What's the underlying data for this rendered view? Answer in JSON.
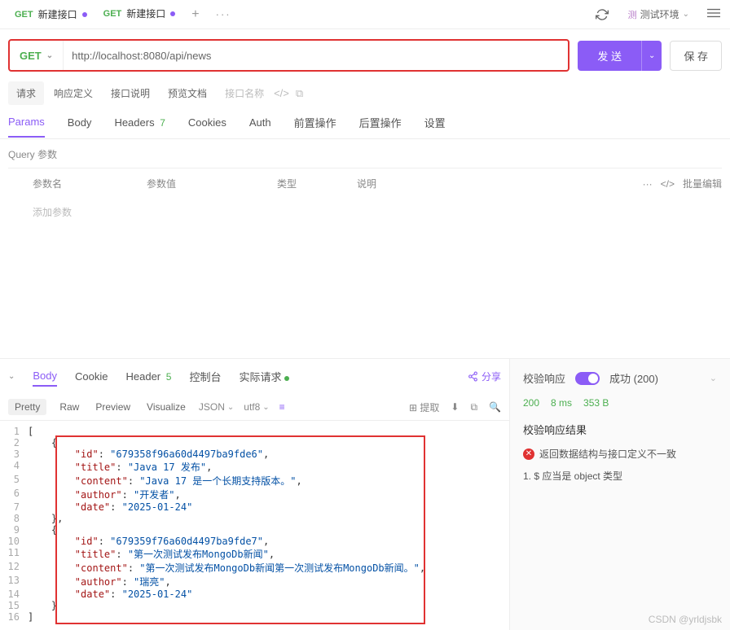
{
  "tabs": [
    {
      "method": "GET",
      "label": "新建接口",
      "modified": true
    },
    {
      "method": "GET",
      "label": "新建接口",
      "modified": true
    }
  ],
  "env": {
    "badge": "测",
    "label": "测试环境"
  },
  "request": {
    "method": "GET",
    "url": "http://localhost:8080/api/news",
    "send": "发 送",
    "save": "保 存"
  },
  "subTabs": {
    "request": "请求",
    "respDef": "响应定义",
    "docDesc": "接口说明",
    "preview": "预览文档",
    "placeholder": "接口名称"
  },
  "reqTabs": {
    "params": "Params",
    "body": "Body",
    "headers": "Headers",
    "headersCount": "7",
    "cookies": "Cookies",
    "auth": "Auth",
    "pre": "前置操作",
    "post": "后置操作",
    "settings": "设置"
  },
  "query": {
    "title": "Query 参数",
    "colName": "参数名",
    "colValue": "参数值",
    "colType": "类型",
    "colDesc": "说明",
    "batch": "批量编辑",
    "addPlaceholder": "添加参数"
  },
  "respTabs": {
    "body": "Body",
    "cookie": "Cookie",
    "header": "Header",
    "headerCount": "5",
    "console": "控制台",
    "actual": "实际请求",
    "share": "分享"
  },
  "toolbar": {
    "pretty": "Pretty",
    "raw": "Raw",
    "preview": "Preview",
    "visualize": "Visualize",
    "format": "JSON",
    "encoding": "utf8",
    "extract": "提取"
  },
  "respRight": {
    "verify": "校验响应",
    "success": "成功 (200)",
    "status": "200",
    "time": "8 ms",
    "size": "353 B",
    "resultTitle": "校验响应结果",
    "error": "返回数据结构与接口定义不一致",
    "rule": "1. $ 应当是 object 类型"
  },
  "json": {
    "lines": [
      {
        "n": 1,
        "indent": 0,
        "raw": "["
      },
      {
        "n": 2,
        "indent": 1,
        "raw": "{"
      },
      {
        "n": 3,
        "indent": 2,
        "key": "id",
        "val": "679358f96a60d4497ba9fde6",
        "comma": true
      },
      {
        "n": 4,
        "indent": 2,
        "key": "title",
        "val": "Java 17 发布",
        "comma": true
      },
      {
        "n": 5,
        "indent": 2,
        "key": "content",
        "val": "Java 17 是一个长期支持版本。",
        "comma": true
      },
      {
        "n": 6,
        "indent": 2,
        "key": "author",
        "val": "开发者",
        "comma": true
      },
      {
        "n": 7,
        "indent": 2,
        "key": "date",
        "val": "2025-01-24"
      },
      {
        "n": 8,
        "indent": 1,
        "raw": "},"
      },
      {
        "n": 9,
        "indent": 1,
        "raw": "{"
      },
      {
        "n": 10,
        "indent": 2,
        "key": "id",
        "val": "679359f76a60d4497ba9fde7",
        "comma": true
      },
      {
        "n": 11,
        "indent": 2,
        "key": "title",
        "val": "第一次测试发布MongoDb新闻",
        "comma": true
      },
      {
        "n": 12,
        "indent": 2,
        "key": "content",
        "val": "第一次测试发布MongoDb新闻第一次测试发布MongoDb新闻。",
        "comma": true
      },
      {
        "n": 13,
        "indent": 2,
        "key": "author",
        "val": "瑞亮",
        "comma": true
      },
      {
        "n": 14,
        "indent": 2,
        "key": "date",
        "val": "2025-01-24"
      },
      {
        "n": 15,
        "indent": 1,
        "raw": "}"
      },
      {
        "n": 16,
        "indent": 0,
        "raw": "]"
      }
    ]
  },
  "watermark": "CSDN @yrldjsbk"
}
